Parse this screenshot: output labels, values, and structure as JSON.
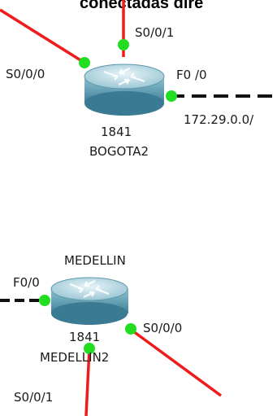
{
  "header": {
    "title_fragment": "conectadas dire"
  },
  "routers": [
    {
      "id": "bogota2",
      "model": "1841",
      "name": "BOGOTA2",
      "caption_above": "",
      "interfaces": [
        "S0/0/1",
        "S0/0/0",
        "F0 /0"
      ],
      "network_label": "172.29.0.0/"
    },
    {
      "id": "medellin2",
      "model": "1841",
      "name": "MEDELLIN2",
      "caption_above": "MEDELLIN",
      "interfaces": [
        "F0/0",
        "S0/0/0",
        "S0/0/1"
      ]
    }
  ],
  "colors": {
    "serial_link": "#ee1c1c",
    "ethernet_link": "#111111",
    "port_up": "#22dd22",
    "router_body": "#6aa3b8",
    "router_top": "#b9dbe7"
  }
}
